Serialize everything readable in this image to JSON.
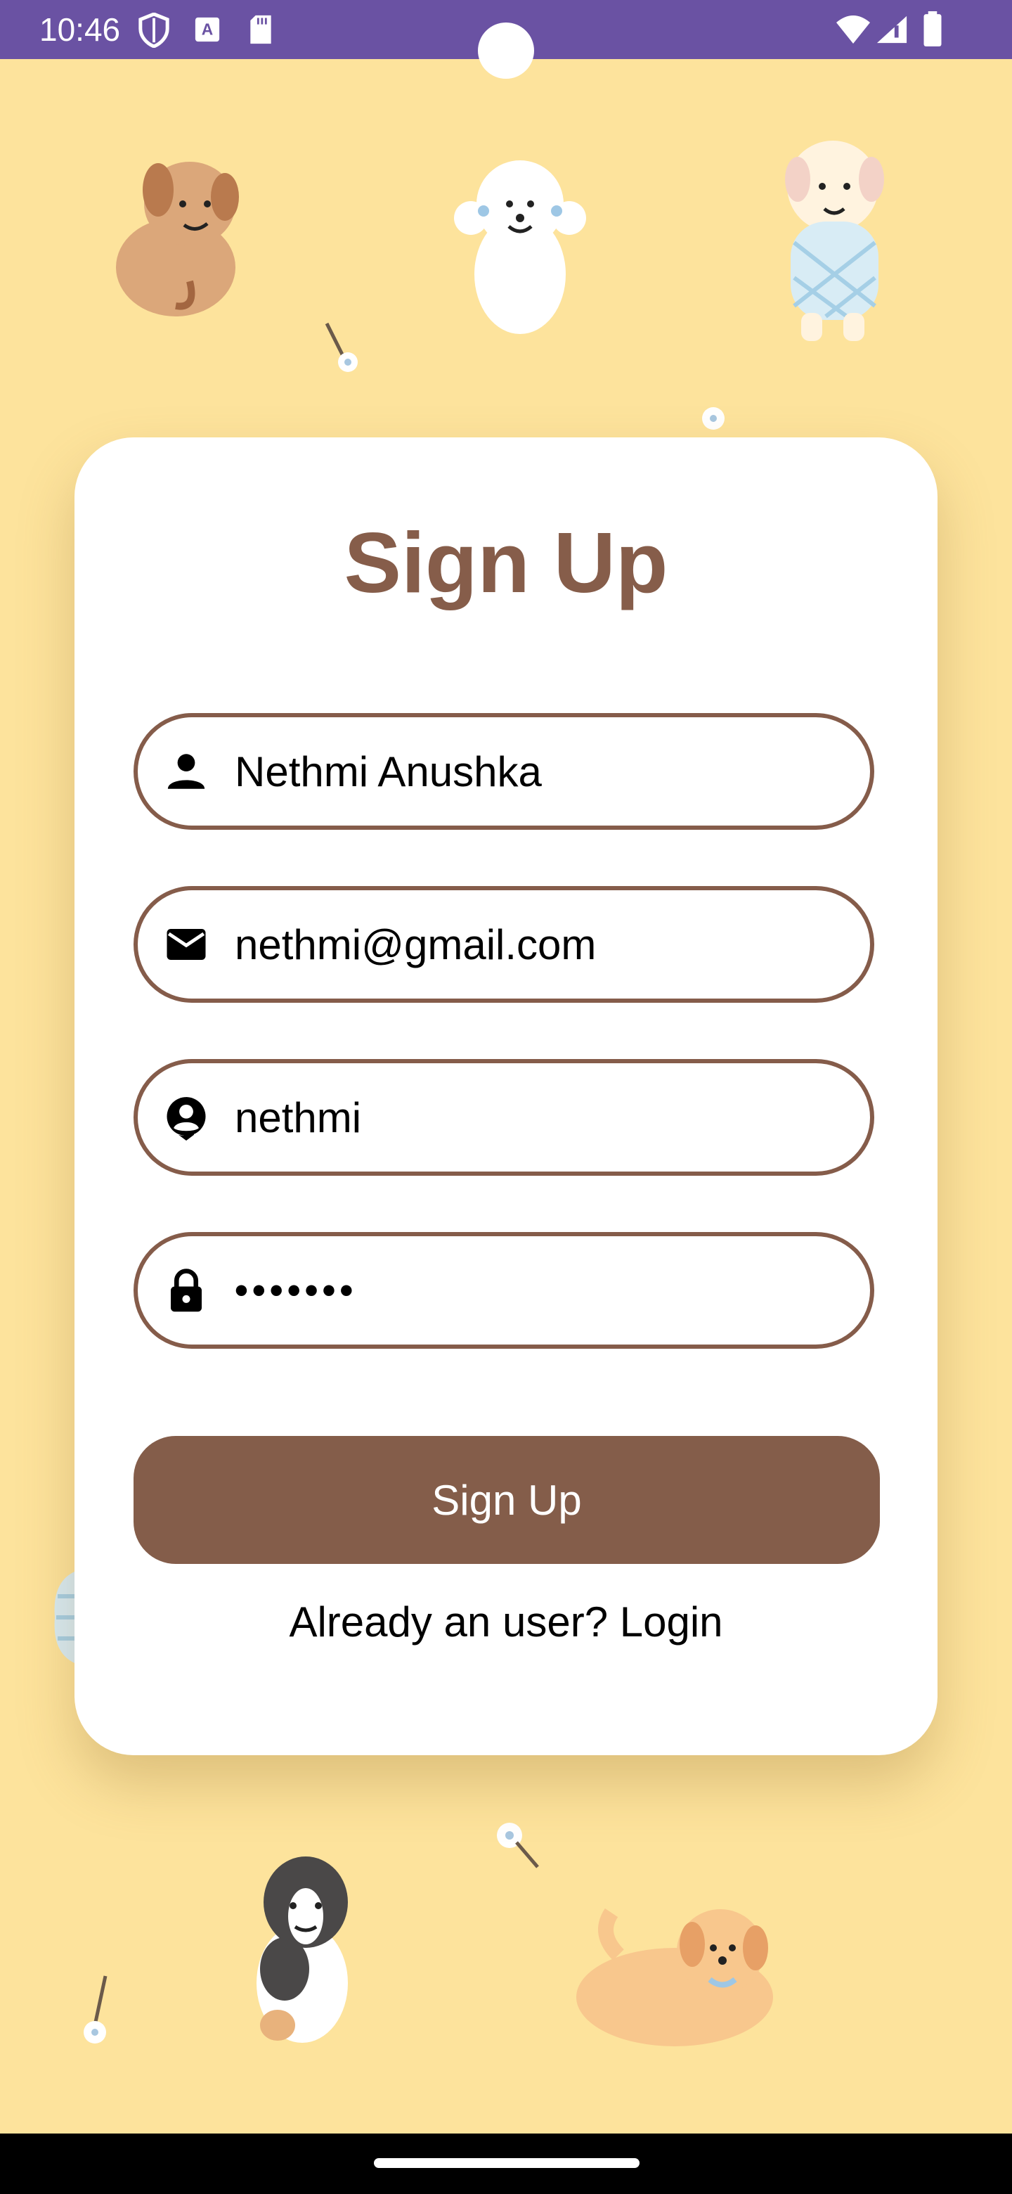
{
  "status_bar": {
    "time": "10:46",
    "left_icons": [
      "shield-icon",
      "font-a-icon",
      "sd-card-icon"
    ],
    "right_icons": [
      "wifi-icon",
      "signal-icon",
      "battery-icon"
    ],
    "background": "#6a52a3"
  },
  "background": {
    "color": "#fde39c",
    "decorations": [
      "dog-icon",
      "dog-icon",
      "dog-icon",
      "dog-icon",
      "dog-icon",
      "flower-icon",
      "flower-icon",
      "flower-icon",
      "flower-icon"
    ]
  },
  "form": {
    "title": "Sign Up",
    "fields": [
      {
        "icon": "person-icon",
        "value": "Nethmi Anushka"
      },
      {
        "icon": "email-icon",
        "value": "nethmi@gmail.com"
      },
      {
        "icon": "account-circle-icon",
        "value": "nethmi"
      },
      {
        "icon": "lock-icon",
        "value": "•••••••"
      }
    ],
    "submit_label": "Sign Up",
    "login_prompt": "Already an user? Login",
    "accent_color": "#855c4a"
  }
}
